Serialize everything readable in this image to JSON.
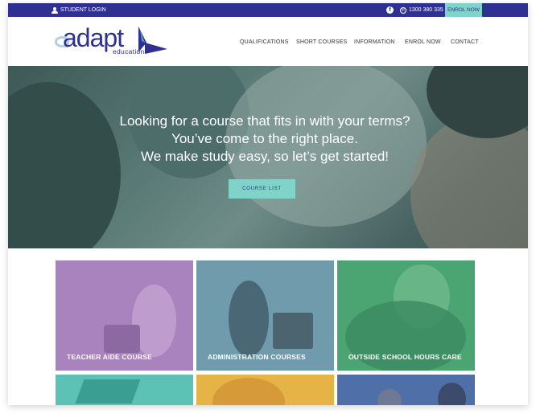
{
  "topbar": {
    "student_login": "STUDENT LOGIN",
    "facebook_glyph": "f",
    "phone_glyph": "✆",
    "phone": "1300 380 335",
    "enrol": "ENROL NOW"
  },
  "logo": {
    "word": "adapt",
    "sub": "education"
  },
  "nav": {
    "items": [
      "QUALIFICATIONS",
      "SHORT COURSES",
      "INFORMATION",
      "ENROL NOW",
      "CONTACT"
    ]
  },
  "hero": {
    "line1": "Looking for a course that fits in with your terms?",
    "line2": "You’ve come to the right place.",
    "line3": "We make study easy, so let’s get started!",
    "button": "COURSE LIST"
  },
  "tiles": [
    {
      "label": "TEACHER AIDE COURSE",
      "color": "#a983bd"
    },
    {
      "label": "ADMINISTRATION COURSES",
      "color": "#6f9bac"
    },
    {
      "label": "OUTSIDE SCHOOL HOURS CARE",
      "color": "#4aa572"
    },
    {
      "label": "",
      "color": "#5cc2b5"
    },
    {
      "label": "",
      "color": "#e6b446"
    },
    {
      "label": "",
      "color": "#4f6fa8"
    }
  ],
  "colors": {
    "brand": "#2e3192",
    "accent": "#7fd3c8"
  }
}
